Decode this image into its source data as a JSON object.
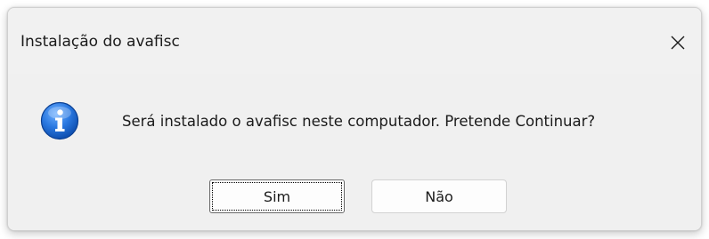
{
  "dialog": {
    "title": "Instalação do avafisc",
    "message": "Será instalado o avafisc neste computador. Pretende Continuar?",
    "icon": "info-icon",
    "close_icon": "close-icon",
    "buttons": {
      "yes_label": "Sim",
      "no_label": "Não"
    },
    "colors": {
      "icon_blue": "#1a6fd6",
      "background": "#f0f0f0"
    }
  }
}
